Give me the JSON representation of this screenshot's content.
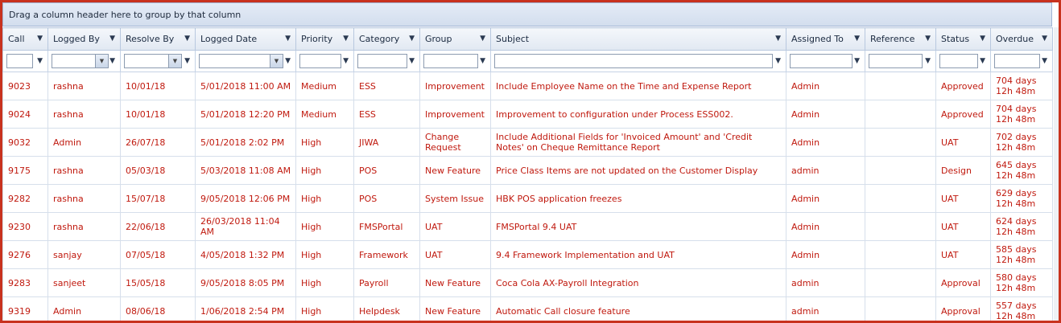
{
  "group_panel": {
    "text": "Drag a column header here to group by that column"
  },
  "columns": [
    {
      "label": "Call"
    },
    {
      "label": "Logged By"
    },
    {
      "label": "Resolve By"
    },
    {
      "label": "Logged Date"
    },
    {
      "label": "Priority"
    },
    {
      "label": "Category"
    },
    {
      "label": "Group"
    },
    {
      "label": "Subject"
    },
    {
      "label": "Assigned To"
    },
    {
      "label": "Reference"
    },
    {
      "label": "Status"
    },
    {
      "label": "Overdue"
    }
  ],
  "icons": {
    "filter": "funnel-icon",
    "dropdown": "chevron-down-icon"
  },
  "colors": {
    "row_text": "#c0190e",
    "frame_border": "#c8321e",
    "header_bg": "#e1e8f2"
  },
  "rows": [
    [
      "9023",
      "rashna",
      "10/01/18",
      "5/01/2018 11:00 AM",
      "Medium",
      "ESS",
      "Improvement",
      "Include Employee Name on the Time and Expense Report",
      "Admin",
      "",
      "Approved",
      "704 days 12h 48m"
    ],
    [
      "9024",
      "rashna",
      "10/01/18",
      "5/01/2018 12:20 PM",
      "Medium",
      "ESS",
      "Improvement",
      "Improvement to configuration under Process ESS002.",
      "Admin",
      "",
      "Approved",
      "704 days 12h 48m"
    ],
    [
      "9032",
      "Admin",
      "26/07/18",
      "5/01/2018 2:02 PM",
      "High",
      "JIWA",
      "Change Request",
      "Include Additional Fields for 'Invoiced Amount' and 'Credit Notes' on Cheque Remittance Report",
      "Admin",
      "",
      "UAT",
      "702 days 12h 48m"
    ],
    [
      "9175",
      "rashna",
      "05/03/18",
      "5/03/2018 11:08 AM",
      "High",
      "POS",
      "New Feature",
      "Price Class Items are not updated on the Customer Display",
      "admin",
      "",
      "Design",
      "645 days 12h 48m"
    ],
    [
      "9282",
      "rashna",
      "15/07/18",
      "9/05/2018 12:06 PM",
      "High",
      "POS",
      "System Issue",
      "HBK POS application freezes",
      "Admin",
      "",
      "UAT",
      "629 days 12h 48m"
    ],
    [
      "9230",
      "rashna",
      "22/06/18",
      "26/03/2018 11:04 AM",
      "High",
      "FMSPortal",
      "UAT",
      "FMSPortal 9.4 UAT",
      "Admin",
      "",
      "UAT",
      "624 days 12h 48m"
    ],
    [
      "9276",
      "sanjay",
      "07/05/18",
      "4/05/2018 1:32 PM",
      "High",
      "Framework",
      "UAT",
      "9.4 Framework Implementation and UAT",
      "Admin",
      "",
      "UAT",
      "585 days 12h 48m"
    ],
    [
      "9283",
      "sanjeet",
      "15/05/18",
      "9/05/2018 8:05 PM",
      "High",
      "Payroll",
      "New Feature",
      "Coca Cola AX-Payroll Integration",
      "admin",
      "",
      "Approval",
      "580 days 12h 48m"
    ],
    [
      "9319",
      "Admin",
      "08/06/18",
      "1/06/2018 2:54 PM",
      "High",
      "Helpdesk",
      "New Feature",
      "Automatic Call closure feature",
      "admin",
      "",
      "Approval",
      "557 days 12h 48m"
    ]
  ]
}
